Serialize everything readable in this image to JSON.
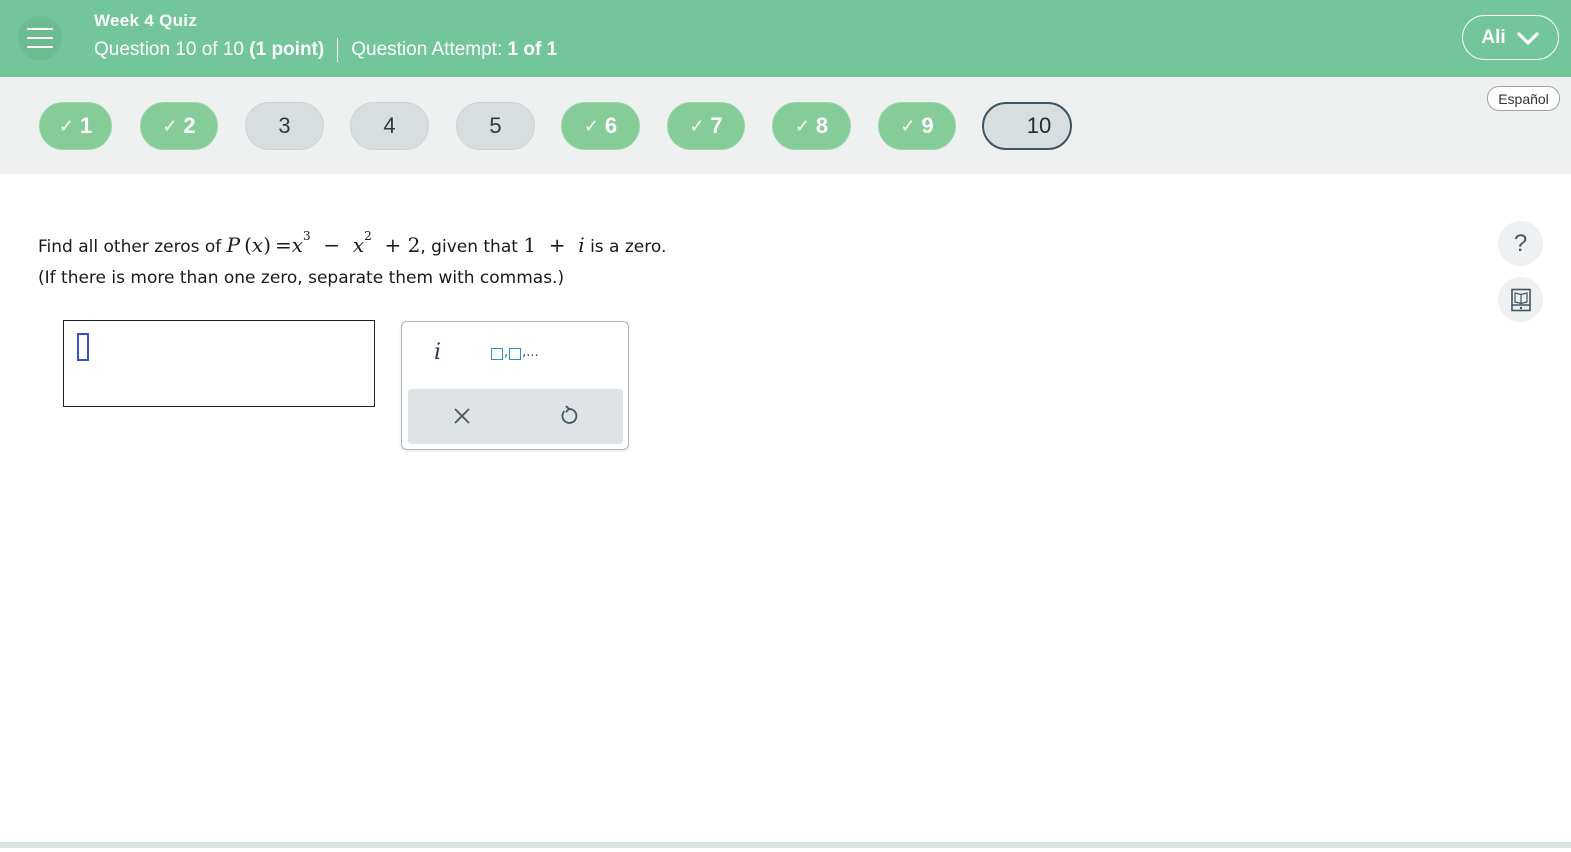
{
  "header": {
    "quiz_title": "Week 4 Quiz",
    "question_label": "Question 10 of 10",
    "points": "(1 point)",
    "attempt_label": "Question Attempt:",
    "attempt_value": "1 of 1",
    "user_name": "Ali",
    "bg_color": "#73c699"
  },
  "nav": {
    "questions": [
      {
        "num": "1",
        "status": "done"
      },
      {
        "num": "2",
        "status": "done"
      },
      {
        "num": "3",
        "status": "todo"
      },
      {
        "num": "4",
        "status": "todo"
      },
      {
        "num": "5",
        "status": "todo"
      },
      {
        "num": "6",
        "status": "done"
      },
      {
        "num": "7",
        "status": "done"
      },
      {
        "num": "8",
        "status": "done"
      },
      {
        "num": "9",
        "status": "done"
      },
      {
        "num": "10",
        "status": "current"
      }
    ],
    "check_mark": "✓",
    "language_button": "Español"
  },
  "question": {
    "prefix": "Find all other zeros of ",
    "func_name": "P",
    "func_arg": "x",
    "equals": "=",
    "var": "x",
    "exp3": "3",
    "minus": "−",
    "exp2": "2",
    "plus_two": "+ 2",
    "comma_given": ", given that ",
    "zero_real": "1",
    "zero_plus": "+",
    "zero_imag": "i",
    "suffix": " is a zero.",
    "instruction": "(If there is more than one zero, separate them with commas.)"
  },
  "answer": {
    "value": ""
  },
  "palette": {
    "imag_unit": "i",
    "list_suffix": ",...",
    "list_sep": ","
  },
  "sidebar": {
    "help_label": "?"
  }
}
